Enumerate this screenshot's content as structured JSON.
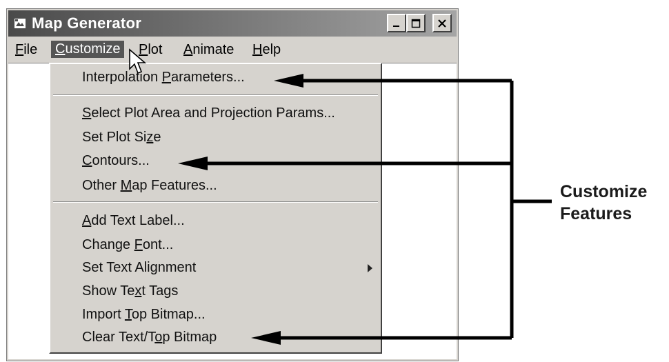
{
  "window": {
    "title": "Map Generator",
    "controls": [
      "minimize-icon",
      "maximize-icon",
      "close-icon"
    ]
  },
  "menubar": [
    {
      "label": "File",
      "mnemonic_index": 0
    },
    {
      "label": "Customize",
      "mnemonic_index": 0,
      "active": true
    },
    {
      "label": "Plot",
      "mnemonic_index": 0
    },
    {
      "label": "Animate",
      "mnemonic_index": 0
    },
    {
      "label": "Help",
      "mnemonic_index": 0
    }
  ],
  "customize_menu": {
    "group1": [
      {
        "label": "Interpolation Parameters...",
        "mnemonic": "P"
      }
    ],
    "group2": [
      {
        "label": "Select Plot Area and Projection Params...",
        "mnemonic": "S"
      },
      {
        "label": "Set Plot Size",
        "mnemonic": "z"
      },
      {
        "label": "Contours...",
        "mnemonic": "C"
      },
      {
        "label": "Other Map Features...",
        "mnemonic": "M"
      }
    ],
    "group3": [
      {
        "label": "Add Text Label...",
        "mnemonic": "A"
      },
      {
        "label": "Change Font...",
        "mnemonic": "F"
      },
      {
        "label": "Set Text Alignment",
        "mnemonic": "g",
        "submenu": true
      },
      {
        "label": "Show Text Tags",
        "mnemonic": "x"
      },
      {
        "label": "Import Top Bitmap...",
        "mnemonic": "T"
      },
      {
        "label": "Clear Text/Top Bitmap",
        "mnemonic": "o"
      }
    ]
  },
  "callout": {
    "line1": "Customize",
    "line2": "Features",
    "points_to": [
      "Interpolation Parameters...",
      "Contours...",
      "Clear Text/Top Bitmap"
    ]
  },
  "colors": {
    "titlebar_dark": "#4a4a4a",
    "menu_face": "#d6d3ce",
    "highlight": "#555555",
    "arrow": "#000000"
  }
}
